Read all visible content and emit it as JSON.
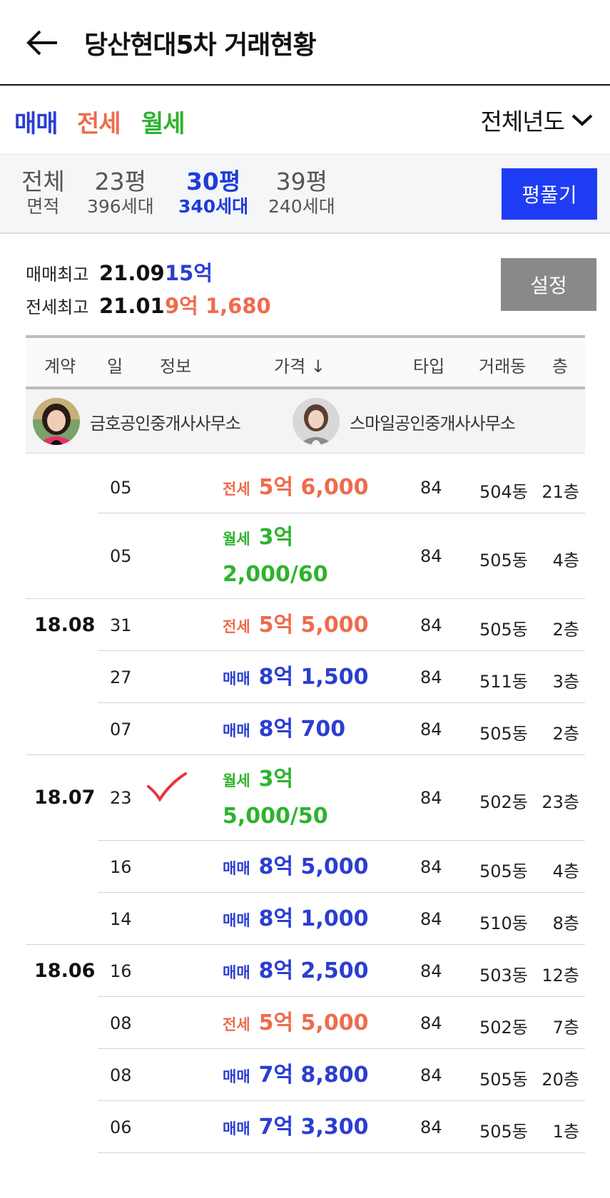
{
  "header": {
    "title": "당산현대5차 거래현황",
    "back_icon": "arrow-left-icon"
  },
  "deal_types": {
    "sale": "매매",
    "jeonse": "전세",
    "wolse": "월세",
    "colors": {
      "sale": "#2b3ed1",
      "jeonse": "#ee6b4d",
      "wolse": "#2db32d"
    }
  },
  "year_filter": {
    "label": "전체년도",
    "icon": "chevron-down-icon"
  },
  "areas": [
    {
      "big": "전체",
      "small": "면적",
      "active": false
    },
    {
      "big": "23평",
      "small": "396세대",
      "active": false
    },
    {
      "big": "30평",
      "small": "340세대",
      "active": true
    },
    {
      "big": "39평",
      "small": "240세대",
      "active": false
    }
  ],
  "solve_button": "평풀기",
  "summary": {
    "sale_label": "매매최고",
    "sale_date": "21.09",
    "sale_price": "15억",
    "jeonse_label": "전세최고",
    "jeonse_date": "21.01",
    "jeonse_price": "9억 1,680",
    "settings_button": "설정"
  },
  "table_headers": {
    "contract": "계약",
    "day": "일",
    "info": "정보",
    "price": "가격 ↓",
    "type": "타입",
    "dong": "거래동",
    "floor": "층"
  },
  "agents": [
    {
      "name": "금호공인중개사사무소"
    },
    {
      "name": "스마일공인중개사사무소"
    }
  ],
  "rows": [
    {
      "month": "",
      "day": "05",
      "kind": "전세",
      "kind_class": "jeonse",
      "price": "5억 6,000",
      "price2": "",
      "type": "84",
      "dong": "504동",
      "floor": "21층",
      "check": false
    },
    {
      "month": "",
      "day": "05",
      "kind": "월세",
      "kind_class": "wolse",
      "price": "3억",
      "price2": "2,000/60",
      "type": "84",
      "dong": "505동",
      "floor": "4층",
      "check": false
    },
    {
      "month": "18.08",
      "day": "31",
      "kind": "전세",
      "kind_class": "jeonse",
      "price": "5억 5,000",
      "price2": "",
      "type": "84",
      "dong": "505동",
      "floor": "2층",
      "check": false
    },
    {
      "month": "",
      "day": "27",
      "kind": "매매",
      "kind_class": "sale",
      "price": "8억 1,500",
      "price2": "",
      "type": "84",
      "dong": "511동",
      "floor": "3층",
      "check": false
    },
    {
      "month": "",
      "day": "07",
      "kind": "매매",
      "kind_class": "sale",
      "price": "8억 700",
      "price2": "",
      "type": "84",
      "dong": "505동",
      "floor": "2층",
      "check": false
    },
    {
      "month": "18.07",
      "day": "23",
      "kind": "월세",
      "kind_class": "wolse",
      "price": "3억",
      "price2": "5,000/50",
      "type": "84",
      "dong": "502동",
      "floor": "23층",
      "check": true
    },
    {
      "month": "",
      "day": "16",
      "kind": "매매",
      "kind_class": "sale",
      "price": "8억 5,000",
      "price2": "",
      "type": "84",
      "dong": "505동",
      "floor": "4층",
      "check": false
    },
    {
      "month": "",
      "day": "14",
      "kind": "매매",
      "kind_class": "sale",
      "price": "8억 1,000",
      "price2": "",
      "type": "84",
      "dong": "510동",
      "floor": "8층",
      "check": false
    },
    {
      "month": "18.06",
      "day": "16",
      "kind": "매매",
      "kind_class": "sale",
      "price": "8억 2,500",
      "price2": "",
      "type": "84",
      "dong": "503동",
      "floor": "12층",
      "check": false
    },
    {
      "month": "",
      "day": "08",
      "kind": "전세",
      "kind_class": "jeonse",
      "price": "5억 5,000",
      "price2": "",
      "type": "84",
      "dong": "502동",
      "floor": "7층",
      "check": false
    },
    {
      "month": "",
      "day": "08",
      "kind": "매매",
      "kind_class": "sale",
      "price": "7억 8,800",
      "price2": "",
      "type": "84",
      "dong": "505동",
      "floor": "20층",
      "check": false
    },
    {
      "month": "",
      "day": "06",
      "kind": "매매",
      "kind_class": "sale",
      "price": "7억 3,300",
      "price2": "",
      "type": "84",
      "dong": "505동",
      "floor": "1층",
      "check": false
    }
  ]
}
